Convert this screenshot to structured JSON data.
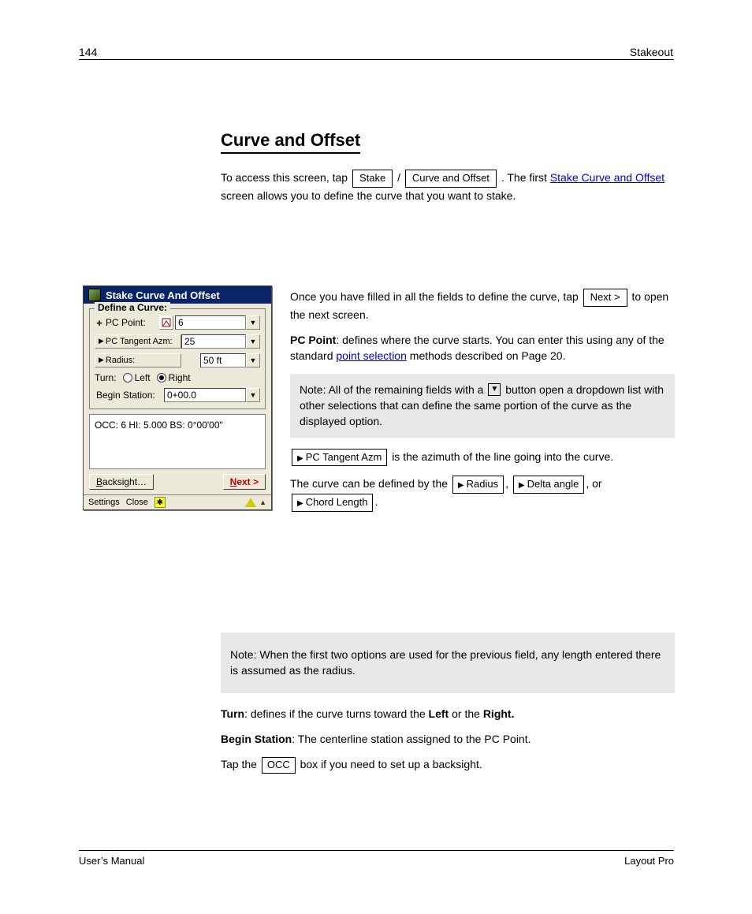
{
  "page_header": "Stakeout",
  "page_number_top": "144",
  "section_title": "Curve and Offset",
  "intro": {
    "p1_a": "To access this screen, tap ",
    "btn_stake": "Stake",
    "p1_b": " / ",
    "btn_curveoffset": "Curve and Offset",
    "p1_c": ". The first ",
    "link": "Stake Curve and Offset",
    "p1_d": " screen allows you to define the curve that you want to stake.",
    "p2_a": "",
    "p3_a": "",
    "p3_btn": "Next >",
    "p3_b": " to open the next screen."
  },
  "dialog": {
    "title": "Stake Curve And Offset",
    "group_legend": "Define a Curve:",
    "pc_point_label": "PC Point:",
    "pc_point_value": "6",
    "pc_tangent_label": "PC Tangent Azm:",
    "pc_tangent_value": "25",
    "radius_label": "Radius:",
    "radius_value": "50 ft",
    "turn_label": "Turn:",
    "turn_left": "Left",
    "turn_right": "Right",
    "begin_station_label": "Begin Station:",
    "begin_station_value": "0+00.0",
    "occ_status": "OCC: 6  HI: 5.000  BS: 0°00'00\"",
    "backsight": "Backsight…",
    "next": "Next >",
    "settings": "Settings",
    "close": "Close"
  },
  "body": {
    "pc_a": "PC Point",
    "pc_b": ": defines where the curve starts. You can enter this using any of the standard ",
    "pc_link": "point selection",
    "pc_c": " methods described on Page ",
    "pc_page": "20",
    "pc_d": ".",
    "note1": "Note: All of the remaining fields with a ",
    "note1b": " button open a dropdown list with other selections that can define the same portion of the curve as the displayed option.",
    "tan_btn": "PC Tangent Azm",
    "tan_text": " is the azimuth of the line going into the curve.",
    "rad_a": "The curve can be defined by the ",
    "rad_btn1": "Radius",
    "rad_b": ", ",
    "rad_btn2": "Delta angle",
    "rad_c": ", or ",
    "rad_btn3": "Chord Length",
    "rad_d": ".",
    "note2": "Note: When the first two options are used for the previous field, any length entered there is assumed as the radius.",
    "turn": "Turn: defines if the curve turns toward the Left or the Right.",
    "begin": "Begin Station: The centerline station assigned to the PC Point.",
    "occ_a": "Tap the ",
    "occ_btn": "OCC",
    "occ_b": " box if you need to set up a backsight."
  },
  "footer_left": "User’s Manual",
  "footer_right": "Layout Pro"
}
